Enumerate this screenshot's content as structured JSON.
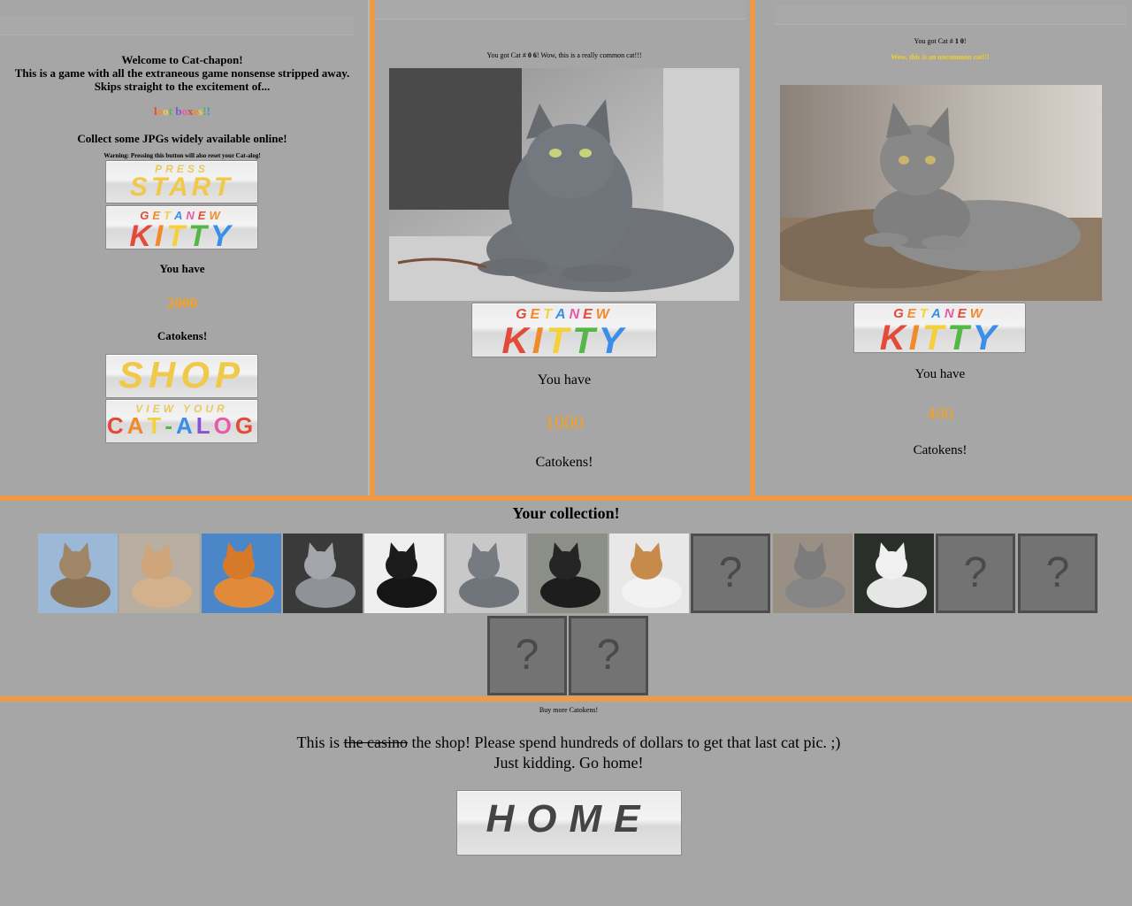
{
  "panel1": {
    "welcome": "Welcome to Cat-chapon!",
    "line2": "This is a game with all the extraneous game nonsense stripped away.",
    "line3": "Skips straight to the excitement of...",
    "loot": "loot boxes!!",
    "collect": "Collect some JPGs widely available online!",
    "warning": "Warning: Pressing this button will also reset your Cat-alog!",
    "start_small": "PRESS",
    "start_big": "START",
    "kitty_small": "GET A NEW",
    "kitty_big": "KITTY",
    "you_have": "You have",
    "amount": "2000",
    "catokens": "Catokens!",
    "shop": "SHOP",
    "catalog_small": "VIEW YOUR",
    "catalog_big": "CAT-ALOG"
  },
  "panel2": {
    "result_prefix": "You got Cat # ",
    "cat_number": "0 6",
    "result_suffix": "! Wow, this is a really common cat!!!",
    "kitty_small": "GET A NEW",
    "kitty_big": "KITTY",
    "you_have": "You have",
    "amount": "1000",
    "catokens": "Catokens!"
  },
  "panel3": {
    "result_prefix": "You got Cat # ",
    "cat_number": "1 0",
    "result_suffix": "!",
    "rarity": "Wow, this is an uncommon cat!!!",
    "kitty_small": "GET A NEW",
    "kitty_big": "KITTY",
    "you_have": "You have",
    "amount": "400",
    "catokens": "Catokens!"
  },
  "collection": {
    "title": "Your collection!",
    "mystery_symbol": "?"
  },
  "shop": {
    "header": "Buy more Catokens!",
    "text_prefix": "This is ",
    "text_strike": "the casino",
    "text_suffix": " the shop! Please spend hundreds of dollars to get that last cat pic. ;)",
    "line2": "Just kidding. Go home!",
    "home": "HOME"
  },
  "colors": {
    "accent_orange": "#ef9a46",
    "amount_orange": "#f6a020",
    "uncommon_yellow": "#f5d020",
    "background": "#a6a6a6"
  }
}
